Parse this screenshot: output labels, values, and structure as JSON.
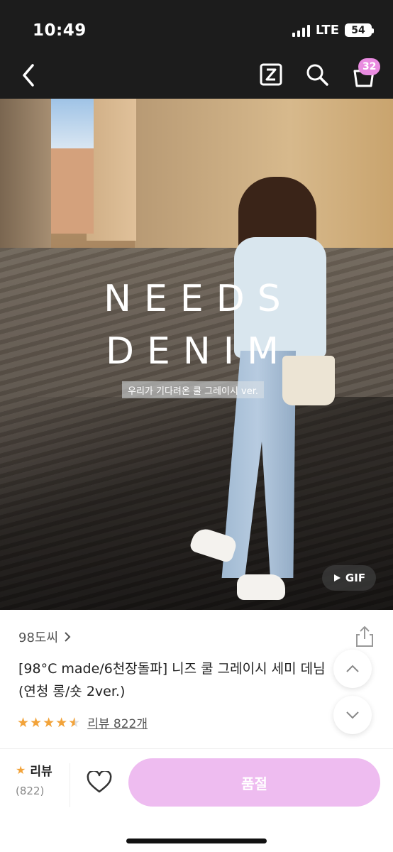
{
  "status_bar": {
    "time": "10:49",
    "network": "LTE",
    "battery": "54"
  },
  "header": {
    "back_icon": "chevron-left-icon",
    "z_icon": "z-box-icon",
    "search_icon": "search-icon",
    "cart_icon": "shopping-bag-icon",
    "cart_count": "32",
    "badge_color": "#e98be0"
  },
  "hero": {
    "title_line1": "NEEDS",
    "title_line2": "DENIM",
    "subtitle": "우리가 기다려온 쿨 그레이시 ver.",
    "gif_label": "GIF"
  },
  "product": {
    "shop_name": "98도씨",
    "title": "[98°C made/6천장돌파] 니즈 쿨 그레이시 세미 데님 (연청 롱/숏 2ver.)",
    "rating": 4.5,
    "review_link": "리뷰 822개"
  },
  "bottom_bar": {
    "review_label": "리뷰",
    "review_count": "(822)",
    "buy_button": "품절",
    "buy_color": "#eebcf0",
    "star_color": "#f2a33a"
  }
}
